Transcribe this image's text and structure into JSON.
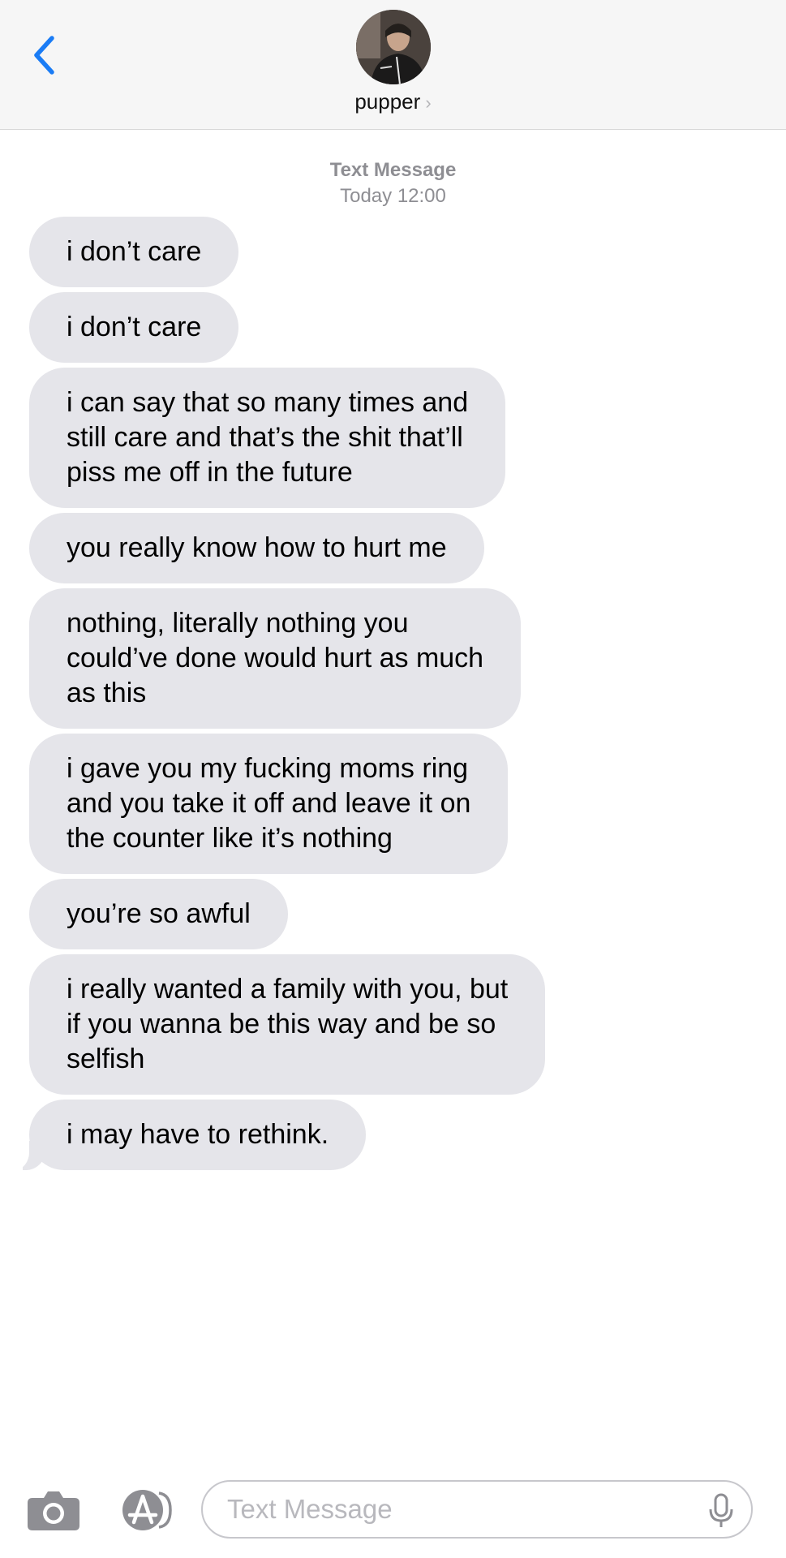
{
  "header": {
    "contact_name": "pupper",
    "chevron": "›",
    "back_icon": "chevron-left-icon",
    "accent_color": "#1a7cf5"
  },
  "thread_meta": {
    "service_label": "Text Message",
    "timestamp": "Today 12:00"
  },
  "messages": [
    {
      "direction": "incoming",
      "lines": [
        "i don’t care"
      ]
    },
    {
      "direction": "incoming",
      "lines": [
        "i don’t care"
      ]
    },
    {
      "direction": "incoming",
      "lines": [
        "i can say that so many times and",
        "still care and that’s the shit that’ll",
        "piss me off in the future"
      ]
    },
    {
      "direction": "incoming",
      "lines": [
        "you really know how to hurt me"
      ]
    },
    {
      "direction": "incoming",
      "lines": [
        "nothing, literally nothing you",
        "could’ve done would hurt as much",
        "as this"
      ]
    },
    {
      "direction": "incoming",
      "lines": [
        "i gave you my fucking moms ring",
        "and you take it off and leave it on",
        "the counter like it’s nothing"
      ]
    },
    {
      "direction": "incoming",
      "lines": [
        "you’re so awful"
      ]
    },
    {
      "direction": "incoming",
      "lines": [
        "i really wanted a family with you, but",
        "if you wanna be this way and be so",
        "selfish"
      ]
    },
    {
      "direction": "incoming",
      "lines": [
        "i may have to rethink."
      ]
    }
  ],
  "input_bar": {
    "placeholder": "Text Message",
    "value": "",
    "camera_icon": "camera-icon",
    "apps_icon": "app-store-icon",
    "mic_icon": "microphone-icon"
  },
  "colors": {
    "incoming_bubble": "#e5e5ea",
    "meta_text": "#8e8e93",
    "header_bg": "#f6f6f6"
  }
}
